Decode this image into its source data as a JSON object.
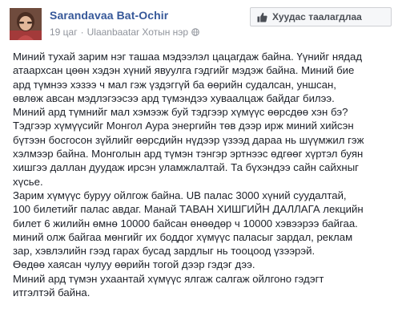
{
  "post": {
    "author": "Sarandavaa Bat-Ochir",
    "time": "19 цаг",
    "separator": "·",
    "location": "Ulaanbaatar Хотын нэр",
    "like_page_label": "Хуудас таалагдлаа",
    "lines": [
      "Миний тухай зарим нэг ташаа мэдээлэл цацагдаж байна. Үүнийг нядад",
      "атаархсан цөөн хэдэн хүний явуулга гэдгийг мэдэж байна. Миний бие",
      "ард түмнээ хэзээ ч мал гэж үздэггүй ба өөрийн судалсан, уншсан,",
      "өвлөж авсан мэдлэгээсээ ард түмэндээ хуваалцаж байдаг билээ.",
      "Миний ард түмнийг мал хэмээж буй тэдгээр хүмүүс өөрсдөө хэн бэ?",
      "Тэдгээр хүмүүсийг Монгол Аура энергийн төв дээр ирж миний хийсэн",
      "бүтээн босгосон зүйлийг өөрсдийн нүдээр үзээд дараа нь шүүмжил гэж",
      "хэлмээр байна. Монголын ард түмэн тэнгэр эртнээс өдгөөг хүртэл буян",
      "хишгээ даллан дуудаж ирсэн уламжлалтай. Та бүхэндээ сайн сайхныг",
      "хүсье.",
      "Зарим хүмүүс буруу ойлгож байна. UB палас 3000 хүний суудалтай,",
      "100 билетийг палас авдаг. Манай ТАВАН ХИШГИЙН ДАЛЛАГА лекцийн",
      "билет 6 жилийн өмнө 10000 байсан өнөөдөр ч 10000 хэвээрээ байгаа.",
      "миний олж байгаа мөнгийг их боддог хүмүүс паласыг зардал, реклам",
      "зар, хэвлэлийн гээд гарах бусад зардлыг нь тооцоод үзээрэй.",
      "Өөдөө хаясан чулуу өөрийн тогой дээр гэдэг дээ.",
      "Миний ард түмэн ухаантай хүмүүс ялгаж салгаж ойлгоно гэдэгт",
      "итгэлтэй байна."
    ]
  },
  "icons": {
    "avatar": "profile-photo",
    "location": "globe-icon",
    "like": "thumbs-up-icon"
  },
  "colors": {
    "author_link": "#365899",
    "meta_text": "#90949c",
    "body_text": "#1d2129"
  }
}
